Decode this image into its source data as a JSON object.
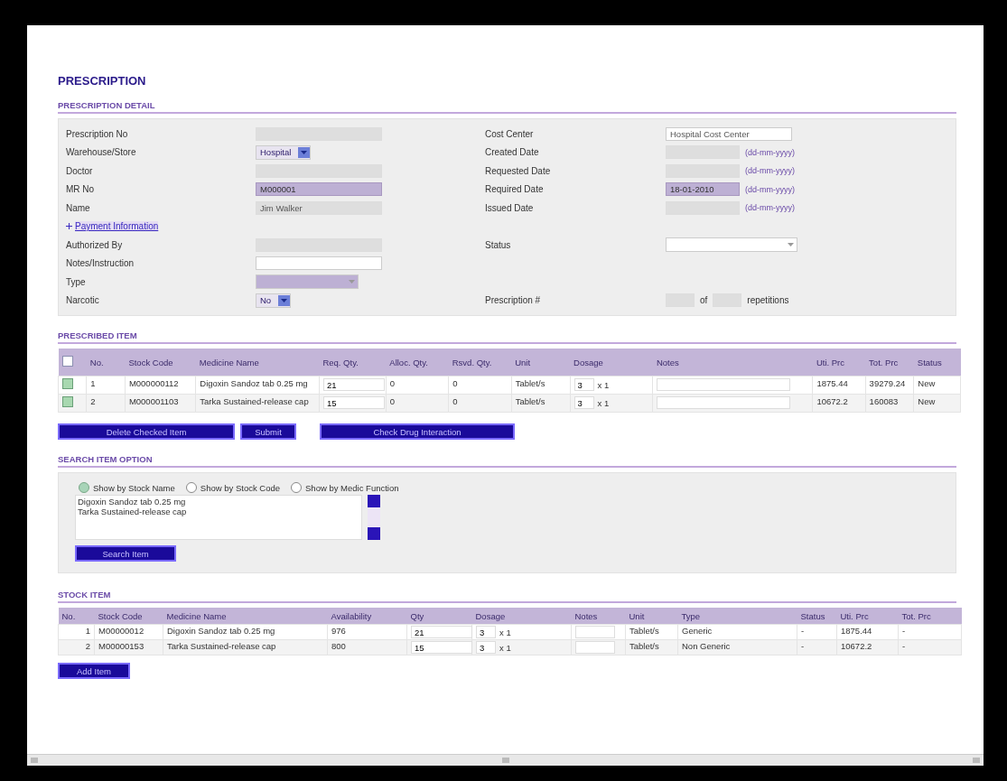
{
  "title": "PRESCRIPTION",
  "detail": {
    "heading": "PRESCRIPTION DETAIL",
    "rows": [
      {
        "left": {
          "label": "Prescription No",
          "field": {
            "kind": "text",
            "readonly": true,
            "highlighted": false
          }
        },
        "right": {
          "label": "Cost Center",
          "field": {
            "kind": "text",
            "value": "Hospital Cost Center",
            "readonly": false,
            "highlighted": false
          }
        }
      },
      {
        "left": {
          "label": "Warehouse/Store",
          "field": {
            "kind": "select",
            "value": "Hospital",
            "highlighted": false
          }
        },
        "right": {
          "label": "Created Date",
          "field": {
            "kind": "date",
            "hint": "(dd-mm-yyyy)",
            "readonly": true,
            "highlighted": false
          }
        }
      },
      {
        "left": {
          "label": "Doctor",
          "field": {
            "kind": "text",
            "readonly": true,
            "highlighted": false
          }
        },
        "right": {
          "label": "Requested Date",
          "field": {
            "kind": "date",
            "hint": "(dd-mm-yyyy)",
            "readonly": true,
            "highlighted": false
          }
        }
      },
      {
        "left": {
          "label": "MR No",
          "field": {
            "kind": "text",
            "value": "M000001",
            "readonly": true,
            "highlighted": true
          }
        },
        "right": {
          "label": "Required Date",
          "field": {
            "kind": "date",
            "value": "18-01-2010",
            "hint": "(dd-mm-yyyy)",
            "readonly": false,
            "highlighted": true
          }
        }
      },
      {
        "left": {
          "label": "Name",
          "field": {
            "kind": "text",
            "value": "Jim Walker",
            "readonly": true,
            "highlighted": false
          }
        },
        "right": {
          "label": "Issued Date",
          "field": {
            "kind": "date",
            "hint": "(dd-mm-yyyy)",
            "readonly": true,
            "highlighted": false
          }
        }
      },
      {
        "left": {
          "kind": "link",
          "label": "Payment Information",
          "expanded": false
        }
      },
      {
        "left": {
          "label": "Authorized By",
          "field": {
            "kind": "text",
            "readonly": true,
            "highlighted": false
          }
        },
        "right": {
          "label": "Status",
          "field": {
            "kind": "select",
            "highlighted": false,
            "wide": true
          }
        }
      },
      {
        "left": {
          "label": "Notes/Instruction",
          "field": {
            "kind": "text",
            "readonly": false,
            "highlighted": false
          }
        }
      },
      {
        "left": {
          "label": "Type",
          "field": {
            "kind": "select",
            "highlighted": true,
            "wide": true
          }
        }
      },
      {
        "left": {
          "label": "Narcotic",
          "field": {
            "kind": "select",
            "value": "No",
            "highlighted": false
          }
        },
        "right": {
          "label": "Prescription #",
          "field": {
            "kind": "repetitions",
            "joiner": "of",
            "suffix": "repetitions"
          }
        }
      }
    ]
  },
  "prescribed": {
    "heading": "PRESCRIBED ITEM",
    "all_checked": false,
    "columns": [
      "No.",
      "Stock Code",
      "Medicine Name",
      "Req. Qty.",
      "Alloc. Qty.",
      "Rsvd. Qty.",
      "Unit",
      "Dosage",
      "Notes",
      "Uti. Prc",
      "Tot. Prc",
      "Status"
    ],
    "rows": [
      {
        "checked": true,
        "no": "1",
        "stock_code": "M000000112",
        "medicine": "Digoxin Sandoz tab 0.25 mg",
        "req_qty": "21",
        "alloc_qty": "0",
        "rsvd_qty": "0",
        "unit": "Tablet/s",
        "dose": "3",
        "times": "x 1",
        "uti_prc": "1875.44",
        "tot_prc": "39279.24",
        "status": "New"
      },
      {
        "checked": true,
        "no": "2",
        "stock_code": "M000001103",
        "medicine": "Tarka Sustained-release cap",
        "req_qty": "15",
        "alloc_qty": "0",
        "rsvd_qty": "0",
        "unit": "Tablet/s",
        "dose": "3",
        "times": "x 1",
        "uti_prc": "10672.2",
        "tot_prc": "160083",
        "status": "New"
      }
    ],
    "buttons": [
      "Delete Checked Item",
      "Submit",
      "Check Drug Interaction"
    ]
  },
  "search": {
    "heading": "SEARCH ITEM OPTION",
    "options": [
      {
        "label": "Show by Stock Name",
        "selected": true
      },
      {
        "label": "Show by Stock Code",
        "selected": false
      },
      {
        "label": "Show by Medic Function",
        "selected": false
      }
    ],
    "results": [
      "Digoxin Sandoz tab 0.25 mg",
      "Tarka Sustained-release cap"
    ],
    "button": "Search Item"
  },
  "stock": {
    "heading": "STOCK ITEM",
    "columns": [
      "No.",
      "Stock Code",
      "Medicine Name",
      "Availability",
      "Qty",
      "Dosage",
      "Notes",
      "Unit",
      "Type",
      "Status",
      "Uti. Prc",
      "Tot. Prc"
    ],
    "rows": [
      {
        "no": "1",
        "stock_code": "M00000012",
        "medicine": "Digoxin Sandoz tab 0.25 mg",
        "availability": "976",
        "qty": "21",
        "dose": "3",
        "times": "x 1",
        "unit": "Tablet/s",
        "type": "Generic",
        "status": "-",
        "uti_prc": "1875.44",
        "tot_prc": "-"
      },
      {
        "no": "2",
        "stock_code": "M00000153",
        "medicine": "Tarka Sustained-release cap",
        "availability": "800",
        "qty": "15",
        "dose": "3",
        "times": "x 1",
        "unit": "Tablet/s",
        "type": "Non Generic",
        "status": "-",
        "uti_prc": "10672.2",
        "tot_prc": "-"
      }
    ],
    "button": "Add Item"
  }
}
